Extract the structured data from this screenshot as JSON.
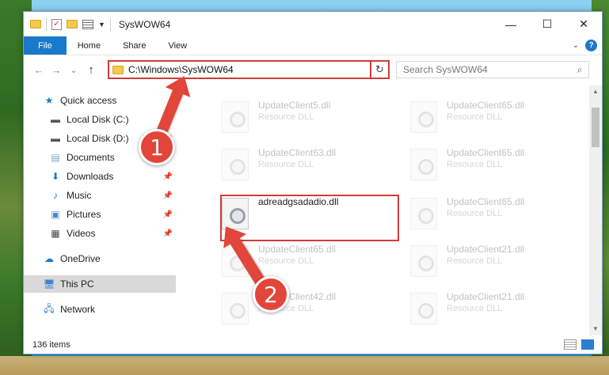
{
  "window": {
    "title": "SysWOW64",
    "minimize": "—",
    "maximize": "☐",
    "close": "✕"
  },
  "ribbon": {
    "tabs": [
      "File",
      "Home",
      "Share",
      "View"
    ],
    "help": "?"
  },
  "nav": {
    "back": "←",
    "forward": "→",
    "recent": "⌄",
    "up": "↑",
    "address": "C:\\Windows\\SysWOW64",
    "search_placeholder": "Search SysWOW64"
  },
  "sidebar": {
    "items": [
      {
        "label": "Quick access",
        "icon": "star-icon"
      },
      {
        "label": "Local Disk (C:)",
        "icon": "drive-icon"
      },
      {
        "label": "Local Disk (D:)",
        "icon": "drive-icon"
      },
      {
        "label": "Documents",
        "icon": "documents-icon"
      },
      {
        "label": "Downloads",
        "icon": "download-icon"
      },
      {
        "label": "Music",
        "icon": "music-icon"
      },
      {
        "label": "Pictures",
        "icon": "pictures-icon"
      },
      {
        "label": "Videos",
        "icon": "videos-icon"
      },
      {
        "label": "OneDrive",
        "icon": "cloud-icon"
      },
      {
        "label": "This PC",
        "icon": "computer-icon"
      },
      {
        "label": "Network",
        "icon": "network-icon"
      }
    ]
  },
  "files": [
    {
      "name": "UpdateClient5.dll",
      "type": "Resource DLL"
    },
    {
      "name": "UpdateClient65.dll",
      "type": "Resource DLL"
    },
    {
      "name": "UpdateClient63.dll",
      "type": "Resource DLL"
    },
    {
      "name": "UpdateClient65.dll",
      "type": "Resource DLL"
    },
    {
      "name": "adreadgsadadio.dll",
      "type": ""
    },
    {
      "name": "UpdateClient65.dll",
      "type": "Resource DLL"
    },
    {
      "name": "UpdateClient65.dll",
      "type": "Resource DLL"
    },
    {
      "name": "UpdateClient21.dll",
      "type": "Resource DLL"
    },
    {
      "name": "UpdateClient42.dll",
      "type": "Resource DLL"
    },
    {
      "name": "UpdateClient21.dll",
      "type": "Resource DLL"
    }
  ],
  "status": {
    "item_count": "136 items"
  },
  "annotations": {
    "step1": "1",
    "step2": "2"
  },
  "colors": {
    "accent": "#1979ca",
    "highlight": "#d23a3a",
    "annotation": "#e2453a"
  }
}
